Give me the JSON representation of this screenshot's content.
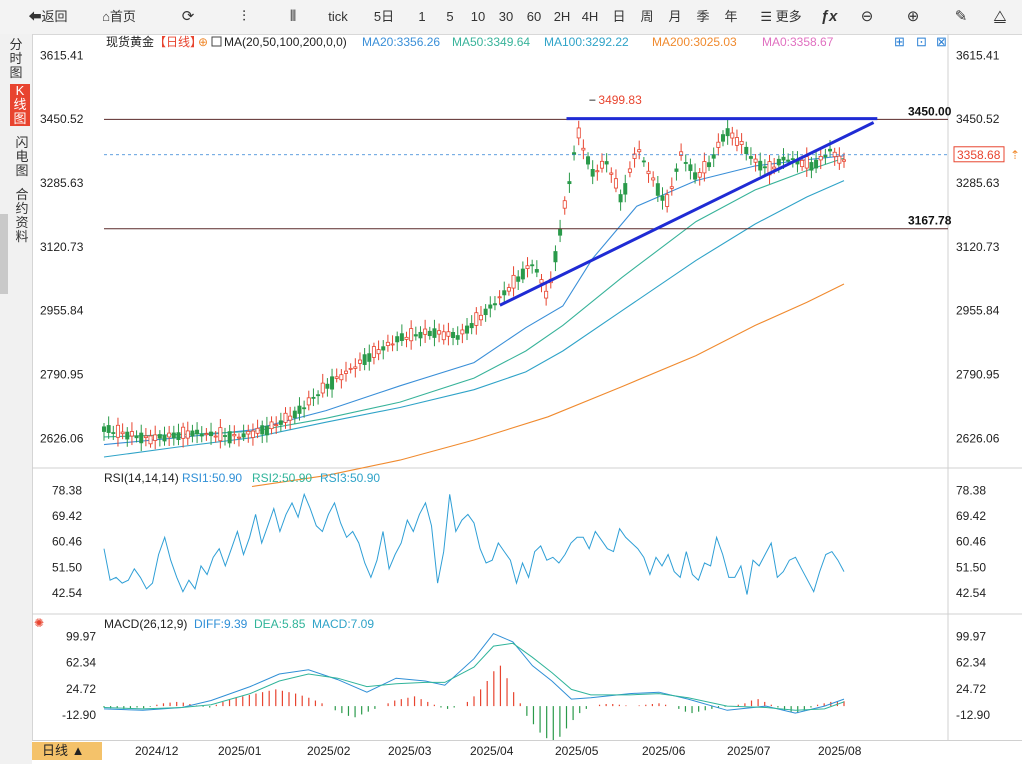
{
  "toolbar": {
    "back": "返回",
    "home": "首页",
    "tick": "tick",
    "periods": [
      "5日",
      "1",
      "5",
      "10",
      "30",
      "60",
      "2H",
      "4H",
      "日",
      "周",
      "月",
      "季",
      "年"
    ],
    "more": "更多"
  },
  "sidebar": {
    "items": [
      "分时图",
      "K线图",
      "闪电图",
      "合约资料"
    ]
  },
  "chart_data": {
    "type": "candlestick",
    "instrument": "现货黄金",
    "timeframe": "日线",
    "x_ticks": [
      "2024/12",
      "2025/01",
      "2025/02",
      "2025/03",
      "2025/04",
      "2025/05",
      "2025/06",
      "2025/07",
      "2025/08"
    ],
    "price_panel": {
      "header": "MA(20,50,100,200,0,0)",
      "ma_labels": [
        {
          "text": "MA20:3356.26",
          "color": "#3a8fd8"
        },
        {
          "text": "MA50:3349.64",
          "color": "#38b39a"
        },
        {
          "text": "MA100:3292.22",
          "color": "#2fa3c8"
        },
        {
          "text": "MA200:3025.03",
          "color": "#f08a2e"
        },
        {
          "text": "MA0:3358.67",
          "color": "#e070c0"
        }
      ],
      "y_ticks": [
        "3615.41",
        "3450.52",
        "3285.63",
        "3120.73",
        "2955.84",
        "2790.95",
        "2626.06"
      ],
      "ylim": [
        2560,
        3650
      ],
      "last_price": "3358.68",
      "high_label": "3499.83",
      "resistance": {
        "label": "3450.00",
        "value": 3450.0
      },
      "support": {
        "label": "3167.78",
        "value": 3167.78
      },
      "ma_series": [
        {
          "name": "MA20",
          "color": "#3a8fd8",
          "points": [
            [
              0,
              2610
            ],
            [
              10,
              2628
            ],
            [
              20,
              2648
            ],
            [
              30,
              2698
            ],
            [
              40,
              2762
            ],
            [
              50,
              2822
            ],
            [
              57,
              2912
            ],
            [
              62,
              2968
            ],
            [
              66,
              3090
            ],
            [
              72,
              3226
            ],
            [
              80,
              3292
            ],
            [
              88,
              3330
            ],
            [
              95,
              3346
            ],
            [
              100,
              3356
            ]
          ]
        },
        {
          "name": "MA50",
          "color": "#38b39a",
          "points": [
            [
              0,
              2630
            ],
            [
              10,
              2636
            ],
            [
              20,
              2644
            ],
            [
              30,
              2678
            ],
            [
              40,
              2720
            ],
            [
              50,
              2782
            ],
            [
              57,
              2852
            ],
            [
              62,
              2918
            ],
            [
              70,
              3042
            ],
            [
              80,
              3186
            ],
            [
              88,
              3268
            ],
            [
              95,
              3318
            ],
            [
              100,
              3350
            ]
          ]
        },
        {
          "name": "MA100",
          "color": "#2fa3c8",
          "points": [
            [
              0,
              2578
            ],
            [
              10,
              2604
            ],
            [
              20,
              2628
            ],
            [
              30,
              2668
            ],
            [
              40,
              2706
            ],
            [
              50,
              2752
            ],
            [
              57,
              2798
            ],
            [
              62,
              2852
            ],
            [
              70,
              2956
            ],
            [
              80,
              3086
            ],
            [
              88,
              3180
            ],
            [
              95,
              3250
            ],
            [
              100,
              3292
            ]
          ]
        },
        {
          "name": "MA200",
          "color": "#f08a2e",
          "points": [
            [
              20,
              2502
            ],
            [
              30,
              2530
            ],
            [
              40,
              2570
            ],
            [
              50,
              2622
            ],
            [
              60,
              2682
            ],
            [
              70,
              2760
            ],
            [
              80,
              2840
            ],
            [
              88,
              2918
            ],
            [
              95,
              2978
            ],
            [
              100,
              3025
            ]
          ]
        }
      ]
    },
    "rsi_panel": {
      "header": "RSI(14,14,14)",
      "labels": [
        {
          "text": "RSI1:50.90",
          "color": "#2f8fd6"
        },
        {
          "text": "RSI2:50.90",
          "color": "#30b49a"
        },
        {
          "text": "RSI3:50.90",
          "color": "#2fa3c8"
        }
      ],
      "y_ticks": [
        "78.38",
        "69.42",
        "60.46",
        "51.50",
        "42.54"
      ],
      "ylim": [
        38,
        82
      ],
      "values": [
        58,
        47,
        48,
        46,
        47,
        51,
        48,
        44,
        46,
        56,
        62,
        54,
        48,
        43,
        47,
        44,
        52,
        49,
        55,
        58,
        52,
        58,
        64,
        56,
        62,
        70,
        60,
        66,
        72,
        64,
        70,
        74,
        69,
        77,
        72,
        66,
        64,
        70,
        74,
        67,
        62,
        64,
        60,
        53,
        48,
        54,
        64,
        51,
        56,
        60,
        68,
        64,
        70,
        74,
        66,
        46,
        57,
        77,
        64,
        68,
        70,
        67,
        58,
        53,
        54,
        60,
        57,
        54,
        46,
        53,
        48,
        57,
        59,
        54,
        55,
        53,
        56,
        60,
        62,
        62,
        58,
        64,
        61,
        58,
        57,
        65,
        62,
        60,
        58,
        55,
        49,
        55,
        52,
        56,
        50,
        48,
        57,
        49,
        47,
        53,
        52,
        62,
        56,
        48,
        48,
        52,
        42,
        54,
        52,
        56,
        60,
        48,
        50,
        54,
        55,
        51,
        47,
        43,
        50,
        56,
        57,
        54,
        50
      ]
    },
    "macd_panel": {
      "header": "MACD(26,12,9)",
      "labels": [
        {
          "text": "DIFF:9.39",
          "color": "#2f8fd6"
        },
        {
          "text": "DEA:5.85",
          "color": "#30b49a"
        },
        {
          "text": "MACD:7.09",
          "color": "#2fa3c8"
        }
      ],
      "y_ticks": [
        "99.97",
        "62.34",
        "24.72",
        "-12.90"
      ],
      "ylim": [
        -40,
        112
      ],
      "diff": [
        [
          0,
          -4
        ],
        [
          8,
          -6
        ],
        [
          16,
          -2
        ],
        [
          22,
          8
        ],
        [
          30,
          28
        ],
        [
          36,
          46
        ],
        [
          42,
          52
        ],
        [
          48,
          38
        ],
        [
          54,
          20
        ],
        [
          60,
          40
        ],
        [
          66,
          36
        ],
        [
          70,
          30
        ],
        [
          76,
          68
        ],
        [
          80,
          104
        ],
        [
          84,
          92
        ],
        [
          88,
          58
        ],
        [
          92,
          36
        ],
        [
          96,
          10
        ],
        [
          100,
          12
        ],
        [
          108,
          18
        ],
        [
          114,
          20
        ],
        [
          120,
          10
        ],
        [
          128,
          -6
        ],
        [
          136,
          0
        ],
        [
          142,
          -10
        ],
        [
          148,
          0
        ],
        [
          152,
          10
        ]
      ],
      "dea": [
        [
          0,
          -2
        ],
        [
          8,
          -4
        ],
        [
          16,
          -2
        ],
        [
          22,
          2
        ],
        [
          30,
          18
        ],
        [
          36,
          36
        ],
        [
          42,
          46
        ],
        [
          48,
          40
        ],
        [
          54,
          28
        ],
        [
          60,
          32
        ],
        [
          66,
          34
        ],
        [
          70,
          34
        ],
        [
          76,
          56
        ],
        [
          80,
          86
        ],
        [
          84,
          90
        ],
        [
          88,
          70
        ],
        [
          92,
          48
        ],
        [
          96,
          24
        ],
        [
          100,
          16
        ],
        [
          108,
          16
        ],
        [
          114,
          18
        ],
        [
          120,
          12
        ],
        [
          128,
          0
        ],
        [
          136,
          -2
        ],
        [
          142,
          -6
        ],
        [
          148,
          -4
        ],
        [
          152,
          6
        ]
      ],
      "hist": [
        -2,
        -3,
        -2,
        -4,
        -3,
        -2,
        -3,
        -1,
        2,
        4,
        5,
        6,
        5,
        3,
        1,
        -1,
        -2,
        2,
        6,
        10,
        12,
        14,
        16,
        18,
        20,
        22,
        24,
        22,
        20,
        18,
        15,
        12,
        8,
        4,
        0,
        -6,
        -10,
        -14,
        -16,
        -12,
        -8,
        -4,
        0,
        4,
        8,
        10,
        12,
        14,
        10,
        6,
        2,
        -2,
        -4,
        -2,
        0,
        6,
        14,
        24,
        36,
        50,
        58,
        40,
        20,
        4,
        -14,
        -26,
        -38,
        -46,
        -52,
        -44,
        -32,
        -20,
        -10,
        -4,
        0,
        2,
        3,
        3,
        2,
        1,
        0,
        1,
        2,
        3,
        4,
        2,
        0,
        -4,
        -8,
        -10,
        -8,
        -6,
        -4,
        -2,
        -1,
        0,
        2,
        4,
        8,
        10,
        6,
        2,
        -2,
        -6,
        -8,
        -10,
        -6,
        -2,
        2,
        4,
        6,
        7,
        7
      ]
    }
  }
}
